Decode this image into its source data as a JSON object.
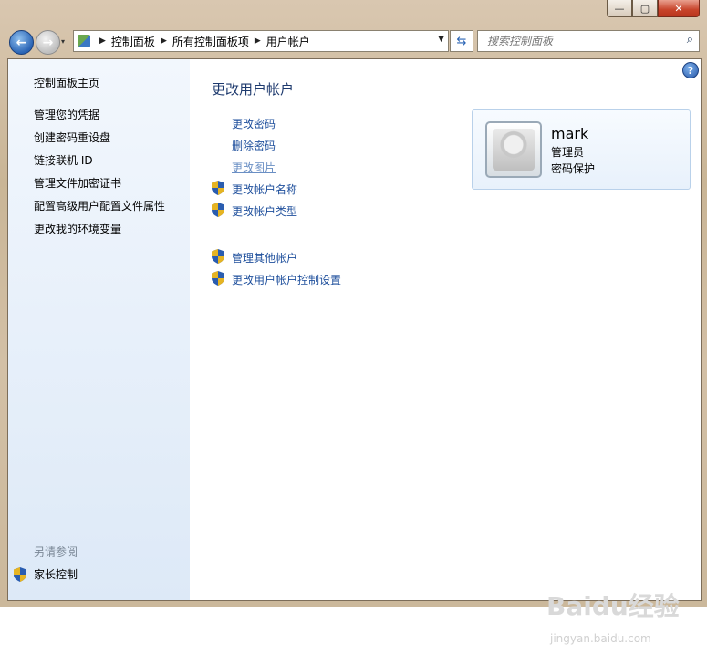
{
  "window": {
    "caption": {
      "minimize": "—",
      "maximize": "▢",
      "close": "✕"
    }
  },
  "nav": {
    "back_icon": "back-arrow-icon",
    "forward_icon": "forward-arrow-icon",
    "breadcrumb": [
      "控制面板",
      "所有控制面板项",
      "用户帐户"
    ],
    "search_placeholder": "搜索控制面板"
  },
  "sidebar": {
    "items": [
      "控制面板主页",
      "管理您的凭据",
      "创建密码重设盘",
      "链接联机 ID",
      "管理文件加密证书",
      "配置高级用户配置文件属性",
      "更改我的环境变量"
    ],
    "see_also": "另请参阅",
    "family": "家长控制"
  },
  "main": {
    "title": "更改用户帐户",
    "links": [
      {
        "label": "更改密码",
        "shield": false,
        "muted": false
      },
      {
        "label": "删除密码",
        "shield": false,
        "muted": false
      },
      {
        "label": "更改图片",
        "shield": false,
        "muted": true
      },
      {
        "label": "更改帐户名称",
        "shield": true,
        "muted": false
      },
      {
        "label": "更改帐户类型",
        "shield": true,
        "muted": false
      },
      {
        "label": "管理其他帐户",
        "shield": true,
        "muted": false
      },
      {
        "label": "更改用户帐户控制设置",
        "shield": true,
        "muted": false
      }
    ],
    "help": "?"
  },
  "account": {
    "name": "mark",
    "role": "管理员",
    "protection": "密码保护"
  },
  "watermark": {
    "brand": "Baidu经验",
    "url": "jingyan.baidu.com"
  },
  "colors": {
    "link": "#1e4f9c",
    "title": "#1e3a6e",
    "sidebar_bg": "#dde9f7"
  }
}
